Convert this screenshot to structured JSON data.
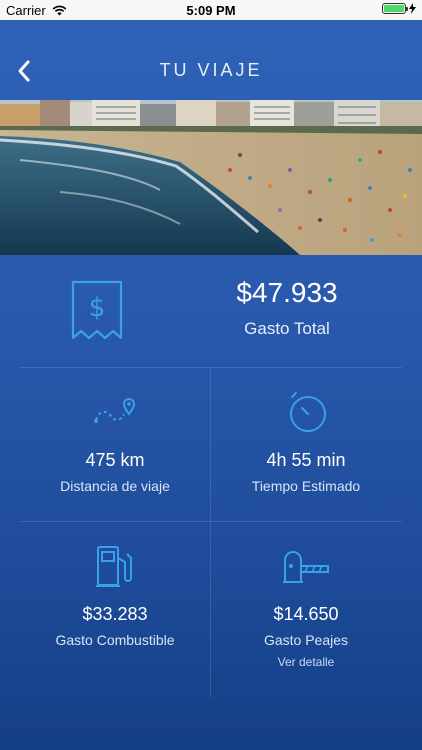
{
  "status_bar": {
    "carrier": "Carrier",
    "time": "5:09 PM"
  },
  "header": {
    "title": "TU VIAJE",
    "back_icon": "chevron-left-icon"
  },
  "summary": {
    "total_amount": "$47.933",
    "total_label": "Gasto Total",
    "icon": "receipt-dollar-icon"
  },
  "stats": [
    {
      "value": "475 km",
      "label": "Distancia de viaje",
      "icon": "route-pin-icon"
    },
    {
      "value": "4h 55 min",
      "label": "Tiempo Estimado",
      "icon": "stopwatch-icon"
    },
    {
      "value": "$33.283",
      "label": "Gasto Combustible",
      "icon": "fuel-pump-icon"
    },
    {
      "value": "$14.650",
      "label": "Gasto Peajes",
      "icon": "toll-barrier-icon",
      "link": "Ver detalle"
    }
  ],
  "colors": {
    "accent": "#3aa0ea",
    "background_top": "#2e63b8",
    "background_bottom": "#143f86"
  }
}
